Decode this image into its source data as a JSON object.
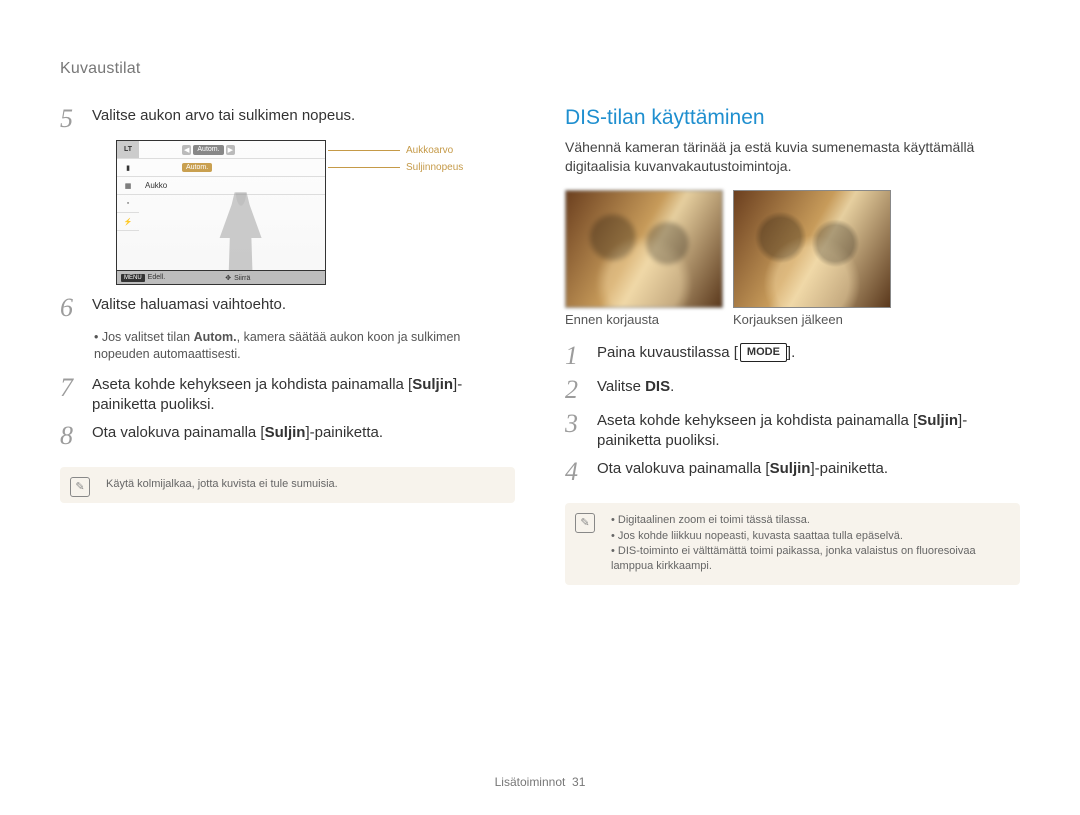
{
  "section_title": "Kuvaustilat",
  "left": {
    "step5": "Valitse aukon arvo tai sulkimen nopeus.",
    "screen": {
      "lt": "LT",
      "autom_tag": "Autom.",
      "aukko": "Aukko",
      "edell": "Edell.",
      "siirra": "Siirrä",
      "menu": "MENU"
    },
    "ann_aukkoarvo": "Aukkoarvo",
    "ann_suljinnopeus": "Suljinnopeus",
    "step6": "Valitse haluamasi vaihtoehto.",
    "step6_sub_pre": "Jos valitset tilan ",
    "step6_sub_bold": "Autom.",
    "step6_sub_post": ", kamera säätää aukon koon ja sulkimen nopeuden automaattisesti.",
    "step7_pre": "Aseta kohde kehykseen ja kohdista painamalla [",
    "step7_bold": "Suljin",
    "step7_post": "]-painiketta puoliksi.",
    "step8_pre": "Ota valokuva painamalla [",
    "step8_bold": "Suljin",
    "step8_post": "]-painiketta.",
    "note": "Käytä kolmijalkaa, jotta kuvista ei tule sumuisia."
  },
  "right": {
    "title": "DIS-tilan käyttäminen",
    "intro": "Vähennä kameran tärinää ja estä kuvia sumenemasta käyttämällä digitaalisia kuvanvakautustoimintoja.",
    "caption_before": "Ennen korjausta",
    "caption_after": "Korjauksen jälkeen",
    "step1_pre": "Paina kuvaustilassa [",
    "step1_chip": "MODE",
    "step1_post": "].",
    "step2_pre": "Valitse ",
    "step2_bold": "DIS",
    "step2_post": ".",
    "step3_pre": "Aseta kohde kehykseen ja kohdista painamalla [",
    "step3_bold": "Suljin",
    "step3_post": "]-painiketta puoliksi.",
    "step4_pre": "Ota valokuva painamalla [",
    "step4_bold": "Suljin",
    "step4_post": "]-painiketta.",
    "note1": "Digitaalinen zoom ei toimi tässä tilassa.",
    "note2": "Jos kohde liikkuu nopeasti, kuvasta saattaa tulla epäselvä.",
    "note3": "DIS-toiminto ei välttämättä toimi paikassa, jonka valaistus on fluoresoivaa lamppua kirkkaampi."
  },
  "footer_label": "Lisätoiminnot",
  "footer_page": "31"
}
